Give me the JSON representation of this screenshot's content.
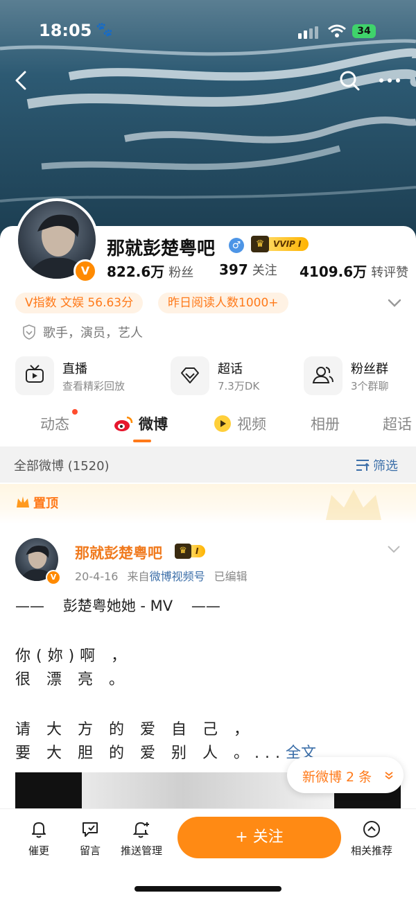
{
  "status": {
    "time": "18:05",
    "battery": "34"
  },
  "profile": {
    "name": "那就彭楚粤吧",
    "vvip": "VVIP",
    "vvip_level": "I",
    "stats": [
      {
        "num": "822.6万",
        "label": "粉丝"
      },
      {
        "num": "397",
        "label": "关注"
      },
      {
        "num": "4109.6万",
        "label": "转评赞"
      }
    ],
    "pills": [
      "V指数 文娱 56.63分",
      "昨日阅读人数1000+"
    ],
    "tags": "歌手，演员，艺人"
  },
  "features": [
    {
      "title": "直播",
      "sub": "查看精彩回放",
      "icon": "tv-icon"
    },
    {
      "title": "超话",
      "sub": "7.3万DK",
      "icon": "diamond-icon"
    },
    {
      "title": "粉丝群",
      "sub": "3个群聊",
      "icon": "group-icon"
    }
  ],
  "tabs": [
    "动态",
    "微博",
    "视频",
    "相册",
    "超话"
  ],
  "active_tab": "微博",
  "feed": {
    "all_label": "全部微博 (1520)",
    "filter_label": "筛选",
    "pinned_label": "置顶"
  },
  "post": {
    "author": "那就彭楚粤吧",
    "badge": "I",
    "date": "20-4-16",
    "from": "来自",
    "source": "微博视频号",
    "edited": "已编辑",
    "mv_line": "——    彭楚粤她她 - MV    ——",
    "lines": [
      "你(妳)啊 ，",
      "很 漂 亮 。",
      "请 大 方 的 爱 自 己 ，",
      "要 大 胆 的 爱 别 人 。..."
    ],
    "full_text": "全文"
  },
  "new_weibo": "新微博 2 条",
  "bottom": {
    "items": [
      {
        "label": "催更",
        "icon": "bell-icon"
      },
      {
        "label": "留言",
        "icon": "message-icon"
      },
      {
        "label": "推送管理",
        "icon": "bell-plus-icon"
      },
      {
        "label": "相关推荐",
        "icon": "chevron-up-circle-icon"
      }
    ],
    "follow_label": "+ 关注"
  },
  "colors": {
    "accent": "#ff8a14",
    "link": "#3b6ea8",
    "pill_bg": "#fff2e4"
  }
}
